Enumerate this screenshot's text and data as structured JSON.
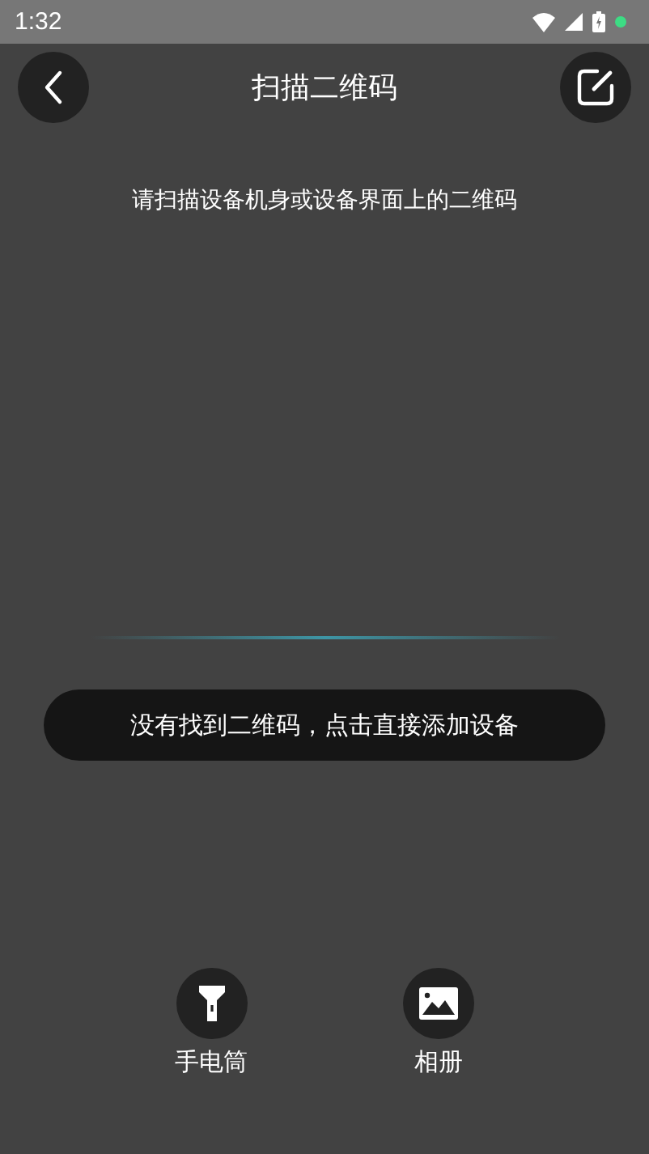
{
  "status_bar": {
    "time": "1:32"
  },
  "header": {
    "title": "扫描二维码"
  },
  "hint": "请扫描设备机身或设备界面上的二维码",
  "add_device_prompt": "没有找到二维码，点击直接添加设备",
  "actions": [
    {
      "kind": "flashlight",
      "label": "手电筒"
    },
    {
      "kind": "album",
      "label": "相册"
    }
  ]
}
